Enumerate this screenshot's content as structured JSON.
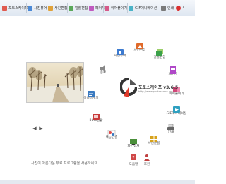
{
  "toolbar": {
    "items": [
      {
        "label": "포토스케이프",
        "color": "#e05a4f"
      },
      {
        "label": "사진뷰어",
        "color": "#4b89d6"
      },
      {
        "label": "사진편집",
        "color": "#e0a23a"
      },
      {
        "label": "일괄편집",
        "color": "#5aa85a"
      },
      {
        "label": "페이지",
        "color": "#c05ac0"
      },
      {
        "label": "이어붙이기",
        "color": "#d65a8a"
      },
      {
        "label": "GIF애니메이션",
        "color": "#4bb3c7"
      },
      {
        "label": "인쇄",
        "color": "#7a7a7a"
      },
      {
        "label": "?",
        "color": "#d93030"
      }
    ]
  },
  "menu": {
    "items": [
      {
        "label": "사진뷰어",
        "color": "#3d7bd0"
      },
      {
        "label": "사진편집",
        "color": "#e06a2a"
      },
      {
        "label": "일괄편집",
        "color": "#3aa04a"
      },
      {
        "label": "페이지",
        "color": "#b048c8"
      },
      {
        "label": "이어붙이기",
        "color": "#d04878"
      },
      {
        "label": "GIF애니메이션",
        "color": "#2fa0c0"
      },
      {
        "label": "인쇄",
        "color": "#666666"
      },
      {
        "label": "사진분할",
        "color": "#d7a21c"
      },
      {
        "label": "화면캡쳐",
        "color": "#4a8f3a"
      },
      {
        "label": "색상검출",
        "color": "#e04a4a"
      },
      {
        "label": "파일이름 바꾸기",
        "color": "#8a5ac8"
      },
      {
        "label": "RAW변환",
        "color": "#c83a3a"
      },
      {
        "label": "이름바꾸기",
        "color": "#3a7ac0"
      },
      {
        "label": "종료",
        "color": "#888888"
      }
    ]
  },
  "logo": {
    "title": "포토스케이프 v3.6.5",
    "url": "http://www.photoscape.org"
  },
  "footer": {
    "status": "사진이 아름다운 무료 프로그램을 사용하세요.",
    "button1": "도움말",
    "button2": "후원"
  },
  "photo_nav": {
    "prev": "◀",
    "next": "▶"
  }
}
